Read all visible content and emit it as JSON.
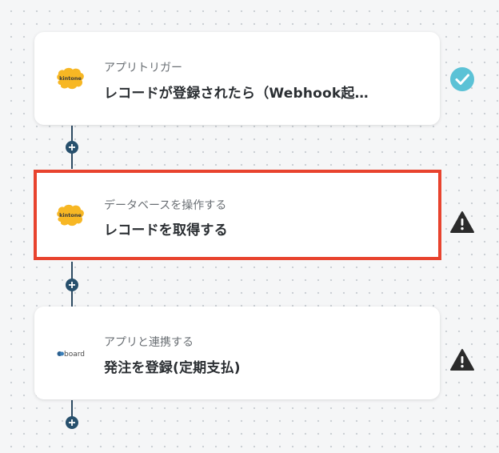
{
  "colors": {
    "connector": "#2d4b63",
    "add_button": "#27506d",
    "selected_border": "#e8432e",
    "success": "#5bc2d6",
    "warning": "#2b2b2b",
    "kintone_yellow": "#f7b724"
  },
  "steps": [
    {
      "subtitle": "アプリトリガー",
      "title": "レコードが登録されたら（Webhook起…",
      "app_icon": "kintone-logo",
      "logo_text": "kintone",
      "status_icon": "check-circle-icon",
      "selected": false
    },
    {
      "subtitle": "データベースを操作する",
      "title": "レコードを取得する",
      "app_icon": "kintone-logo",
      "logo_text": "kintone",
      "status_icon": "warning-icon",
      "selected": true
    },
    {
      "subtitle": "アプリと連携する",
      "title": "発注を登録(定期支払)",
      "app_icon": "board-logo",
      "logo_text": "board",
      "status_icon": "warning-icon",
      "selected": false
    }
  ],
  "add_step_icon": "plus-icon"
}
